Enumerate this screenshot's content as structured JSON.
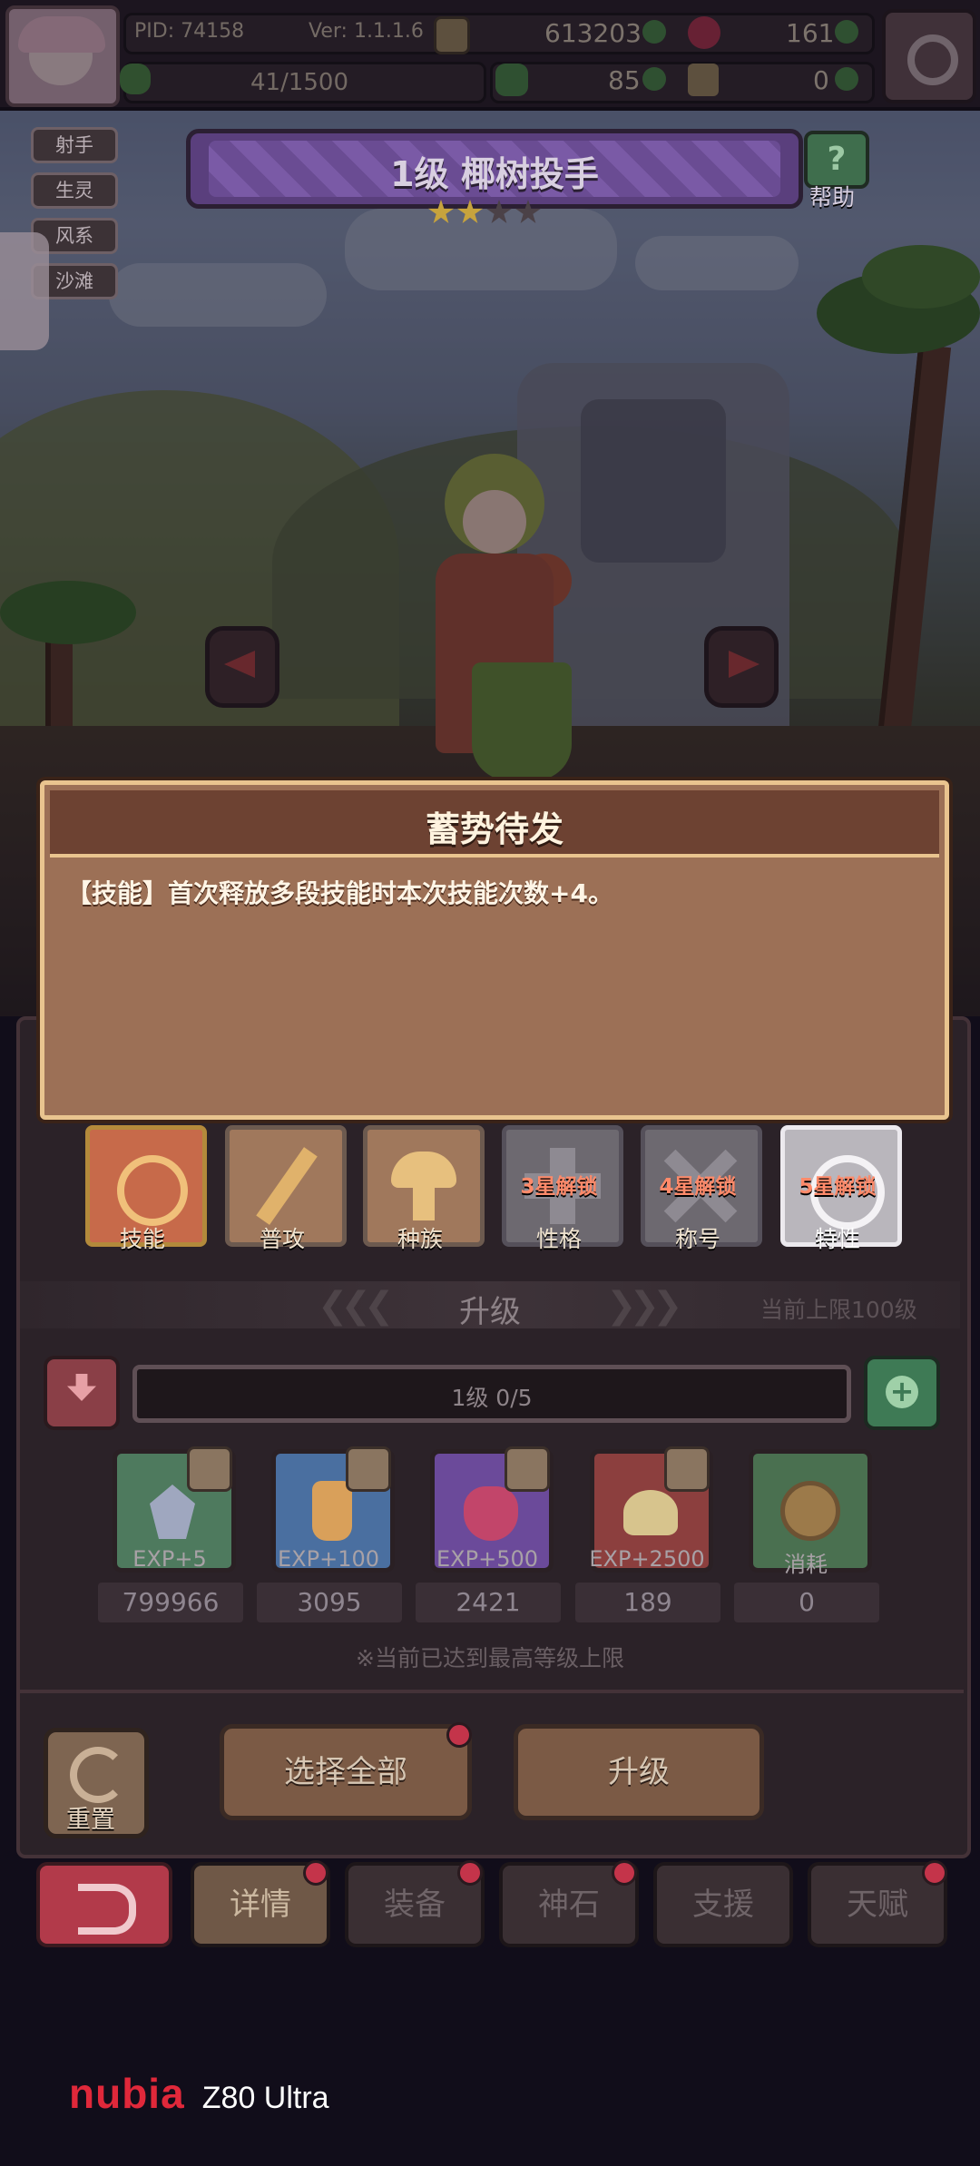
{
  "topbar": {
    "pid": "PID: 74158",
    "version": "Ver: 1.1.1.6",
    "coins": "613203",
    "gems": "161",
    "energy": "41/1500",
    "clover": "85",
    "keys": "0"
  },
  "tags": [
    "射手",
    "生灵",
    "风系",
    "沙滩"
  ],
  "hero": {
    "title": "1级  椰树投手",
    "help_label": "帮助",
    "stars_filled": 2,
    "stars_total": 4
  },
  "tooltip": {
    "title": "蓄势待发",
    "text": "【技能】首次释放多段技能时本次技能次数+4。"
  },
  "skill_tabs": [
    {
      "label": "技能",
      "lock": ""
    },
    {
      "label": "普攻",
      "lock": ""
    },
    {
      "label": "种族",
      "lock": ""
    },
    {
      "label": "性格",
      "lock": "3星解锁"
    },
    {
      "label": "称号",
      "lock": "4星解锁"
    },
    {
      "label": "特性",
      "lock": "5星解锁"
    }
  ],
  "upgrade": {
    "section_title": "升级",
    "limit_text": "当前上限100级",
    "progress_text": "1级  0/5",
    "items": [
      {
        "exp": "EXP+5",
        "count": "799966"
      },
      {
        "exp": "EXP+100",
        "count": "3095"
      },
      {
        "exp": "EXP+500",
        "count": "2421"
      },
      {
        "exp": "EXP+2500",
        "count": "189"
      },
      {
        "exp": "消耗",
        "count": "0"
      }
    ],
    "max_notice": "※当前已达到最高等级上限",
    "reset_label": "重置",
    "select_all_label": "选择全部",
    "upgrade_label": "升级"
  },
  "nav": {
    "tabs": [
      "详情",
      "装备",
      "神石",
      "支援",
      "天赋"
    ]
  },
  "device": {
    "brand": "nubia",
    "model": "Z80 Ultra"
  },
  "colors": {
    "brand": "#e0283a",
    "tooltip_bg": "#9c7056",
    "tooltip_border": "#e9c48f",
    "banner": "#5a3f7d",
    "lock_text": "#ff8a6a"
  }
}
